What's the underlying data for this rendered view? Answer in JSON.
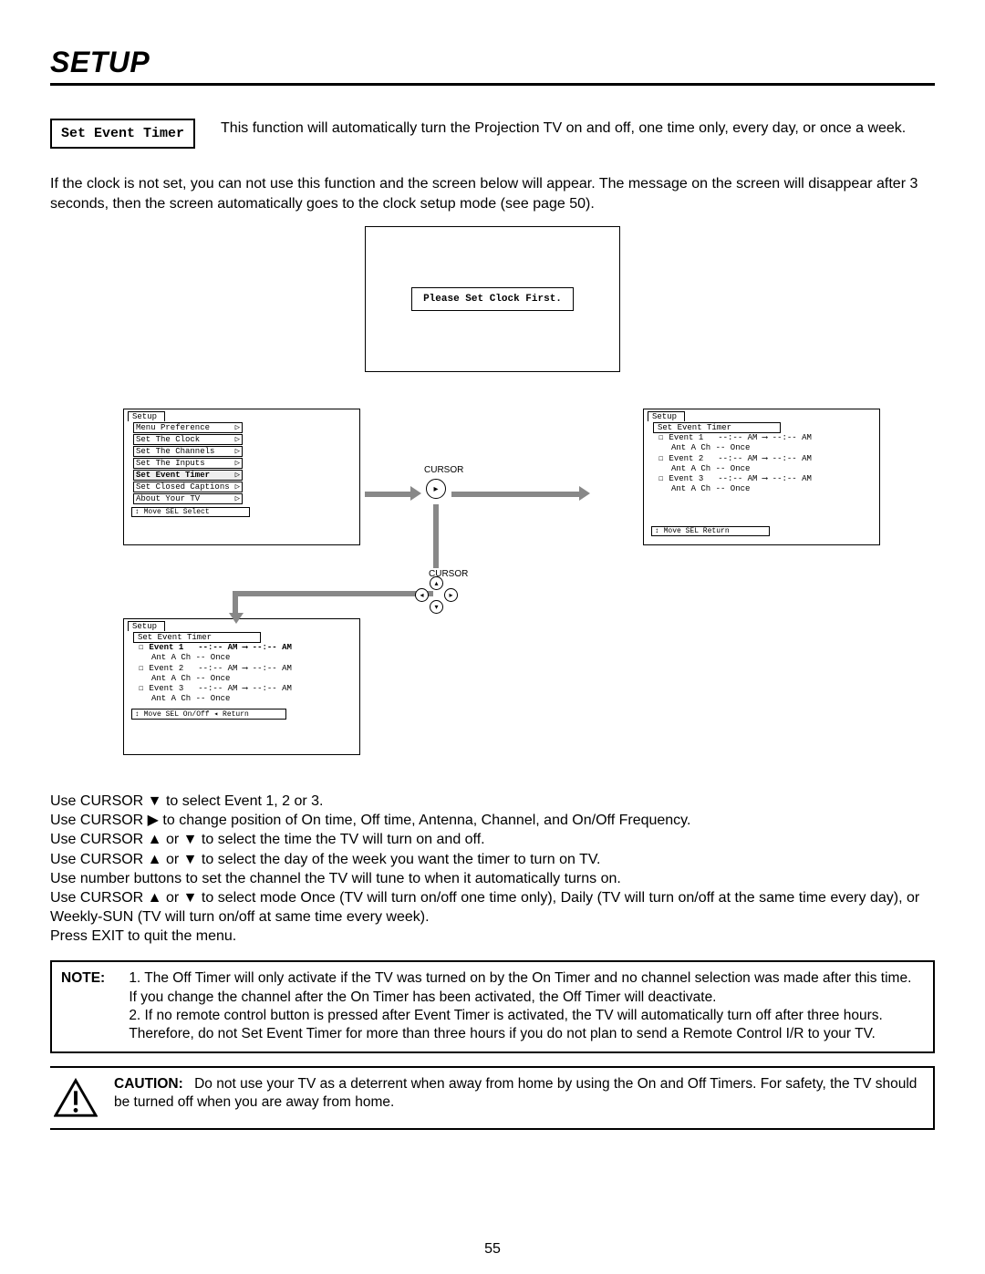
{
  "title": "SETUP",
  "func": {
    "label": "Set Event Timer",
    "desc": "This function will automatically turn the Projection TV on and off, one time only, every day, or once a week."
  },
  "clock_note": "If the clock is not set, you can not use this function and the screen below will appear.  The message on the screen will disappear after 3 seconds, then the screen automatically goes to the clock setup mode (see page 50).",
  "clock_msg": "Please Set Clock First.",
  "screenA": {
    "tab": "Setup",
    "items": [
      "Menu Preference",
      "Set The Clock",
      "Set The Channels",
      "Set The Inputs",
      "Set Event Timer",
      "Set Closed Captions",
      "About Your TV"
    ],
    "selected_index": 4,
    "footer": "↕ Move  SEL  Select"
  },
  "screenB": {
    "tab": "Setup",
    "subtab": "Set Event Timer",
    "events": [
      {
        "name": "Event 1",
        "on": "--:-- AM",
        "off": "--:-- AM",
        "ant": "Ant A",
        "ch": "Ch --",
        "mode": "Once"
      },
      {
        "name": "Event 2",
        "on": "--:-- AM",
        "off": "--:-- AM",
        "ant": "Ant A",
        "ch": "Ch --",
        "mode": "Once"
      },
      {
        "name": "Event 3",
        "on": "--:-- AM",
        "off": "--:-- AM",
        "ant": "Ant A",
        "ch": "Ch --",
        "mode": "Once"
      }
    ],
    "footer": "↕ Move  SEL  Return"
  },
  "screenC": {
    "tab": "Setup",
    "subtab": "Set Event Timer",
    "selected_index": 0,
    "events": [
      {
        "name": "Event 1",
        "on": "--:-- AM",
        "off": "--:-- AM",
        "ant": "Ant A",
        "ch": "Ch --",
        "mode": "Once"
      },
      {
        "name": "Event 2",
        "on": "--:-- AM",
        "off": "--:-- AM",
        "ant": "Ant A",
        "ch": "Ch --",
        "mode": "Once"
      },
      {
        "name": "Event 3",
        "on": "--:-- AM",
        "off": "--:-- AM",
        "ant": "Ant A",
        "ch": "Ch --",
        "mode": "Once"
      }
    ],
    "footer": "↕ Move  SEL On/Off  ◂ Return"
  },
  "cursor_label_right": "CURSOR",
  "cursor_label_pad": "CURSOR",
  "instructions": [
    "Use CURSOR ▼ to select Event 1, 2 or 3.",
    "Use CURSOR ▶ to change position of On time, Off time, Antenna, Channel, and On/Off Frequency.",
    "Use CURSOR ▲ or ▼ to select the time the TV will turn on and off.",
    "Use CURSOR ▲ or ▼ to select the day of the week you want the timer to turn on TV.",
    "Use number buttons to set the channel the TV will tune to when it automatically turns on.",
    "Use CURSOR ▲ or ▼ to select mode Once (TV will turn on/off one time only), Daily (TV will turn on/off at the same time every day), or Weekly-SUN (TV will turn on/off at same time every week).",
    "Press EXIT to quit the menu."
  ],
  "note": {
    "label": "NOTE:",
    "items": [
      "The Off Timer will only activate if the TV was turned on by the On Timer and no channel selection was made after this time.  If you change the channel after the On Timer has been activated, the Off Timer will deactivate.",
      "If no remote control button is pressed after Event Timer is activated, the TV will automatically turn off after three hours. Therefore, do not Set Event Timer for more than three hours if you do not plan to send a Remote Control I/R to your TV."
    ]
  },
  "caution": {
    "label": "CAUTION:",
    "text": "Do not use your TV as a deterrent when away from home by using the On and Off Timers.  For safety, the TV should be turned off when you are away from home."
  },
  "page_number": "55"
}
